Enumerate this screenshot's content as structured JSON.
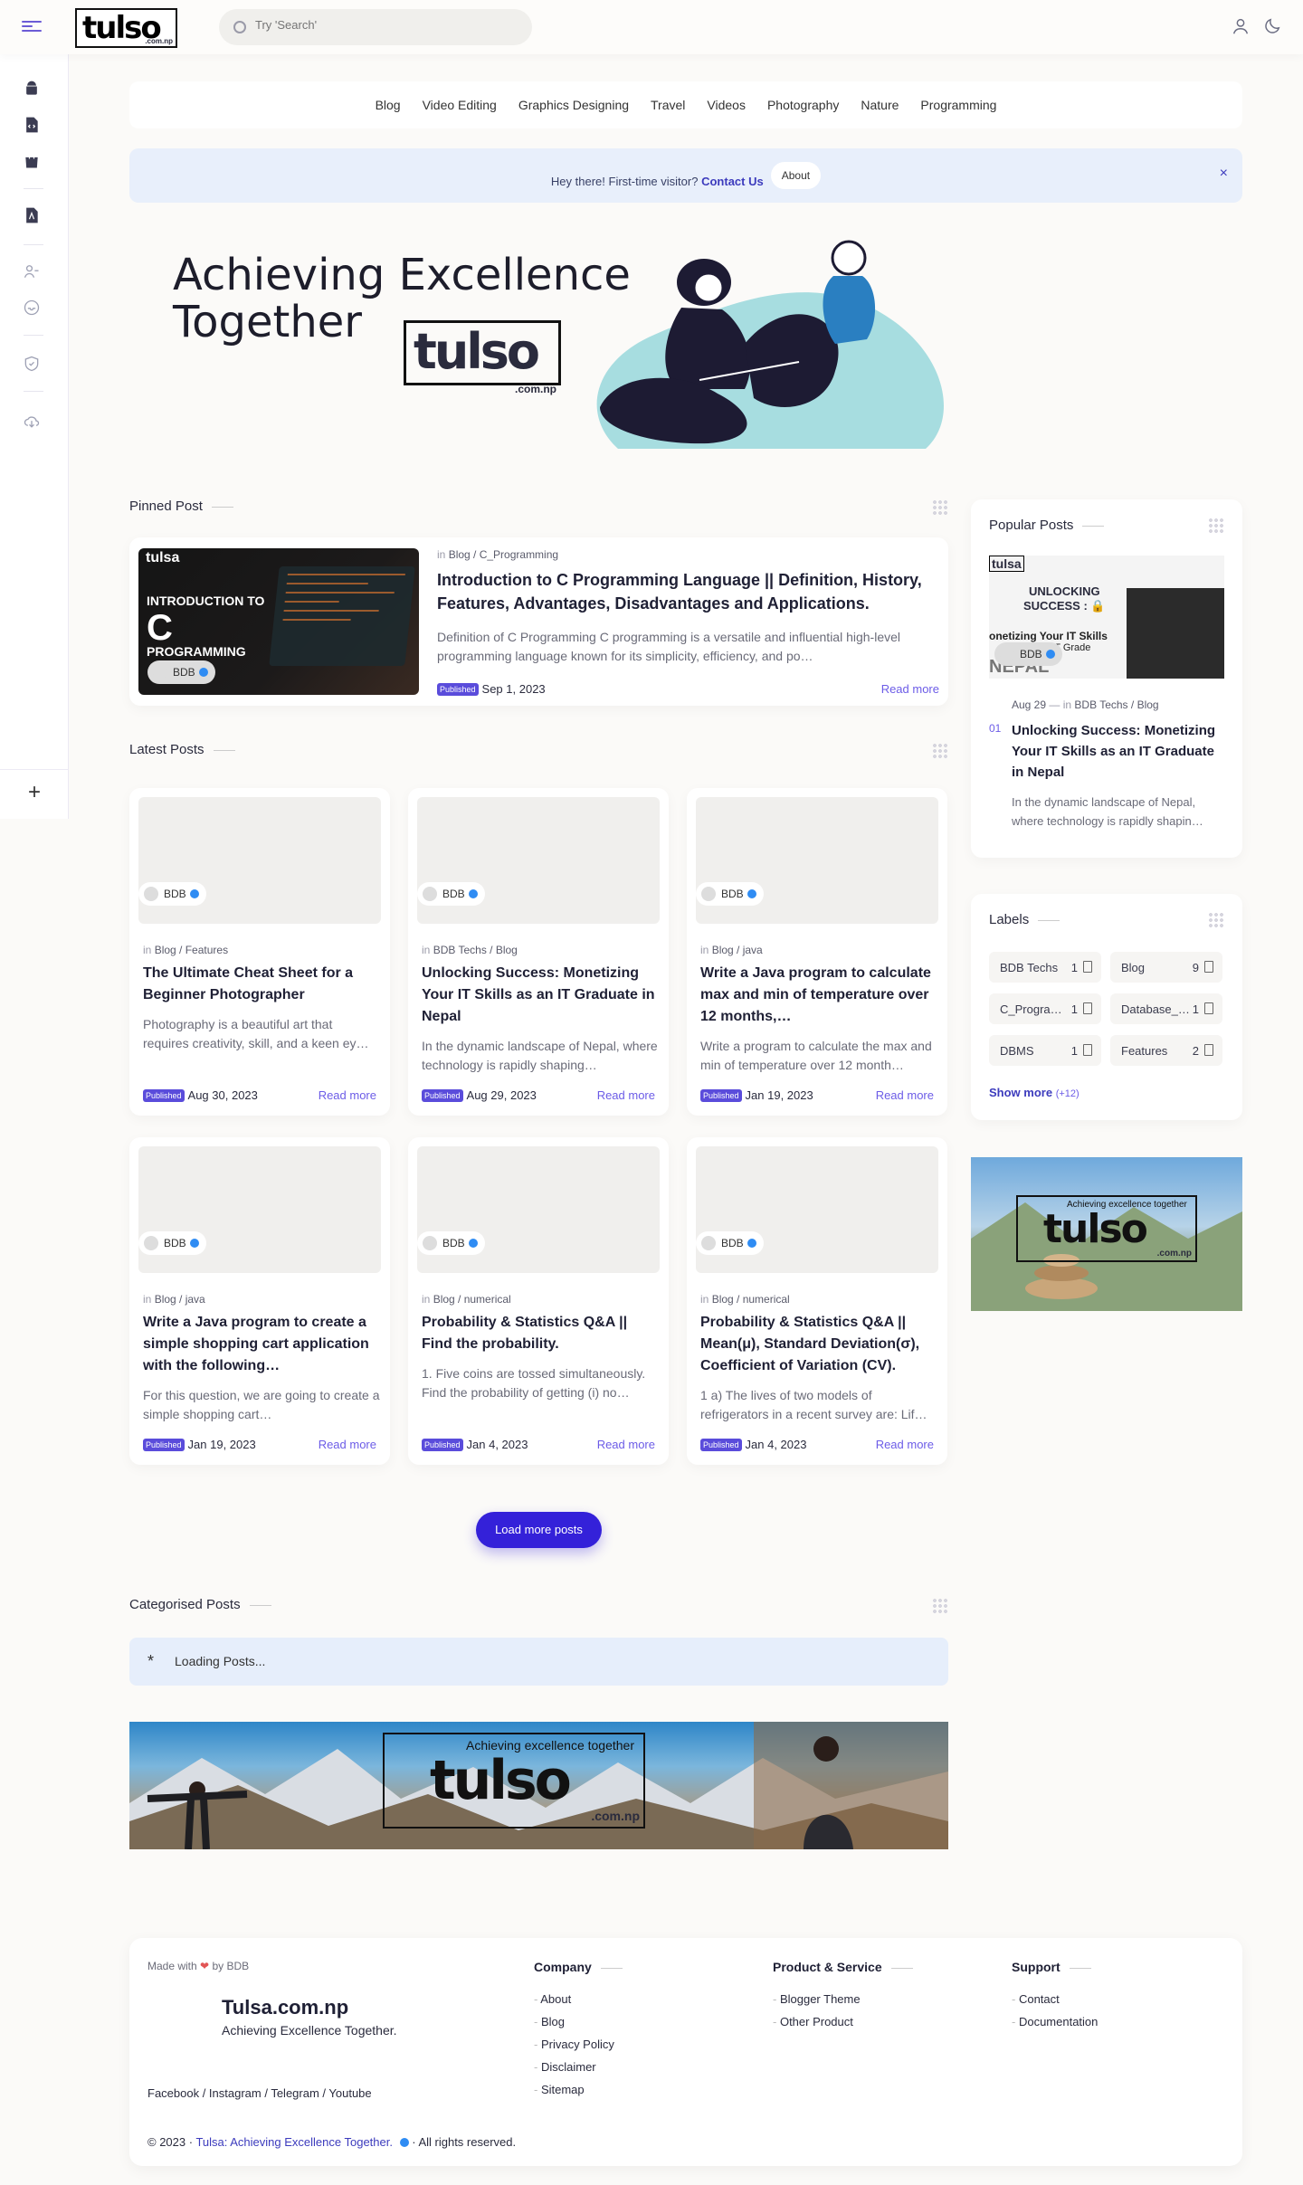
{
  "search": {
    "placeholder": "Try 'Search'"
  },
  "logo": {
    "mark": "tulso",
    "sub": ".com.np"
  },
  "nav": [
    "Blog",
    "Video Editing",
    "Graphics Designing",
    "Travel",
    "Videos",
    "Photography",
    "Nature",
    "Programming"
  ],
  "notice": {
    "text": "Hey there! First-time visitor?",
    "link": "Contact Us",
    "button": "About",
    "close": "×"
  },
  "banner": {
    "line1": "Achieving Excellence",
    "line2": "Together",
    "logo": "tulso",
    "logo_sub": ".com.np"
  },
  "pinned": {
    "section": "Pinned Post",
    "meta_in": "in",
    "labels": "Blog / C_Programming",
    "title": "Introduction to C Programming Language || Definition, History, Features, Advantages, Disadvantages and Applications.",
    "excerpt": "Definition of C Programming C programming is a versatile and influential high-level programming language known for its simplicity, efficiency, and po…",
    "badge": "Published",
    "date": "Sep 1, 2023",
    "read": "Read more",
    "thumb": {
      "t1": "INTRODUCTION TO",
      "t2": "C",
      "t3": "PROGRAMMING",
      "brand": "tulsa",
      "author": "BDB"
    }
  },
  "latest": {
    "section": "Latest Posts",
    "posts": [
      {
        "author": "BDB",
        "labels": "Blog / Features",
        "title": "The Ultimate Cheat Sheet for a Beginner Photographer",
        "excerpt": "Photography is a beautiful art that requires creativity, skill, and a keen ey…",
        "date": "Aug 30, 2023"
      },
      {
        "author": "BDB",
        "labels": "BDB Techs / Blog",
        "title": "Unlocking Success: Monetizing Your IT Skills as an IT Graduate in Nepal",
        "excerpt": "In the dynamic landscape of Nepal, where technology is rapidly shaping…",
        "date": "Aug 29, 2023"
      },
      {
        "author": "BDB",
        "labels": "Blog / java",
        "title": "Write a Java program to calculate max and min of temperature over 12 months,…",
        "excerpt": "Write a program to calculate the max and min of temperature over 12 month…",
        "date": "Jan 19, 2023"
      },
      {
        "author": "BDB",
        "labels": "Blog / java",
        "title": "Write a Java program to create a simple shopping cart application with the following…",
        "excerpt": "For this question, we are going to create a simple shopping cart…",
        "date": "Jan 19, 2023"
      },
      {
        "author": "BDB",
        "labels": "Blog / numerical",
        "title": "Probability & Statistics Q&A || Find the probability.",
        "excerpt": "1. Five coins are tossed simultaneously. Find the probability of getting (i) no…",
        "date": "Jan 4, 2023"
      },
      {
        "author": "BDB",
        "labels": "Blog / numerical",
        "title": "Probability & Statistics Q&A || Mean(μ), Standard Deviation(σ), Coefficient of Variation (CV).",
        "excerpt": "1 a) The lives of two models of refrigerators in a recent survey are: Lif…",
        "date": "Jan 4, 2023"
      }
    ],
    "badge": "Published",
    "in": "in",
    "read": "Read more",
    "load_more": "Load more posts"
  },
  "categorised": {
    "section": "Categorised Posts",
    "loading": "Loading Posts..."
  },
  "popular": {
    "section": "Popular Posts",
    "date": "Aug 29",
    "in": "in",
    "labels": "BDB Techs / Blog",
    "num": "01",
    "title": "Unlocking Success: Monetizing Your IT Skills as an IT Graduate in Nepal",
    "excerpt": "In the dynamic landscape of Nepal, where technology is rapidly shapin…",
    "thumb": {
      "brand": "tulsa",
      "t1": "UNLOCKING",
      "t2": "SUCCESS : 🔒",
      "t3": "onetizing Your IT Skills",
      "t4": "As an IT Grade",
      "t5": "NEPAL",
      "author": "BDB"
    }
  },
  "labels": {
    "section": "Labels",
    "items": [
      {
        "name": "BDB Techs",
        "count": "1"
      },
      {
        "name": "Blog",
        "count": "9"
      },
      {
        "name": "C_Progra…",
        "count": "1"
      },
      {
        "name": "Database_…",
        "count": "1"
      },
      {
        "name": "DBMS",
        "count": "1"
      },
      {
        "name": "Features",
        "count": "2"
      }
    ],
    "show_more": "Show more",
    "more_count": "(+12)"
  },
  "side_ad": {
    "tag": "Achieving excellence together",
    "mark": "tulso",
    "sub": ".com.np"
  },
  "wide_ad": {
    "tag": "Achieving excellence together",
    "mark": "tulso",
    "sub": ".com.np"
  },
  "footer": {
    "made": "Made with",
    "by": "by BDB",
    "site": "Tulsa.com.np",
    "tagline": "Achieving Excellence Together.",
    "social": "Facebook / Instagram / Telegram / Youtube",
    "cols": [
      {
        "title": "Company",
        "links": [
          "About",
          "Blog",
          "Privacy Policy",
          "Disclaimer",
          "Sitemap"
        ]
      },
      {
        "title": "Product & Service",
        "links": [
          "Blogger Theme",
          "Other Product"
        ]
      },
      {
        "title": "Support",
        "links": [
          "Contact",
          "Documentation"
        ]
      }
    ],
    "copy_year": "© 2023 ·",
    "copy_link": "Tulsa: Achieving Excellence Together.",
    "copy_rest": "· All rights reserved."
  },
  "colors": {
    "accent": "#3421d9",
    "link": "#6c5ce7",
    "notice_bg": "#e8effb",
    "badge": "#5a4cdb"
  }
}
